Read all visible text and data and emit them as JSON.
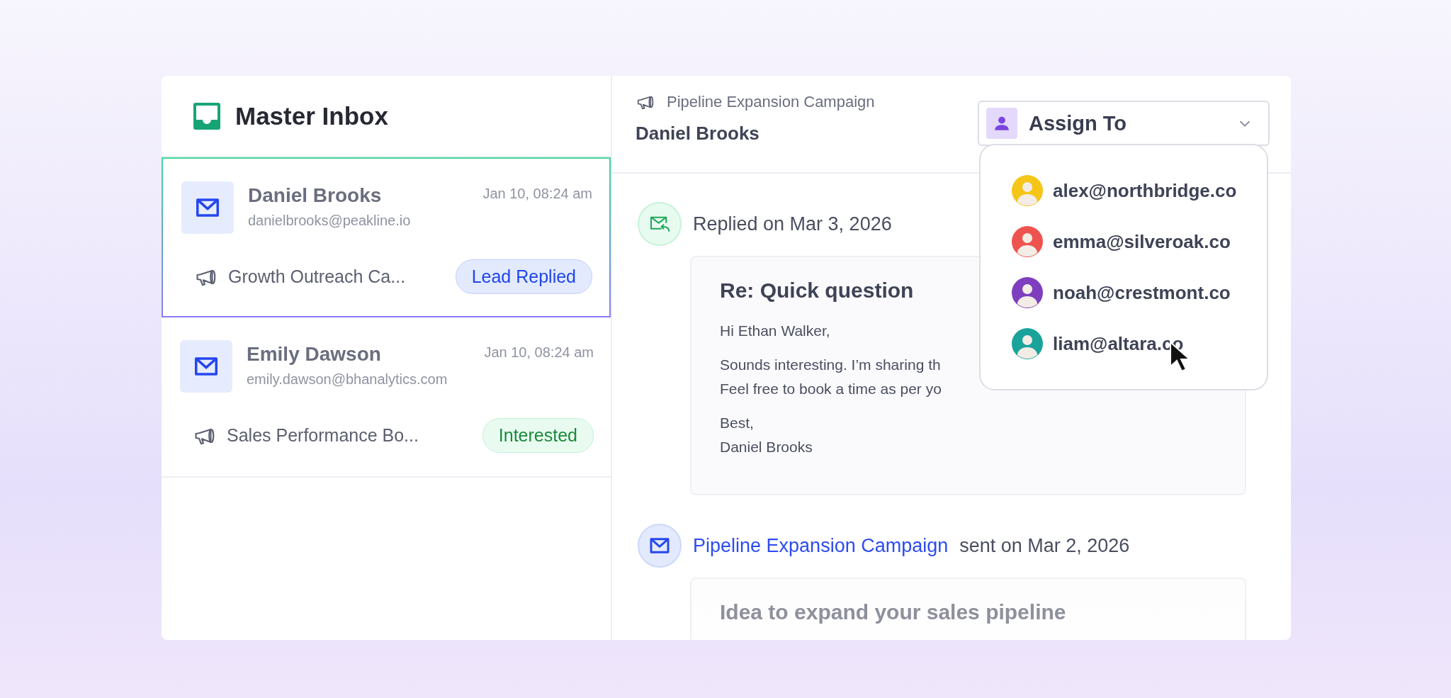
{
  "sidebar": {
    "title": "Master Inbox",
    "conversations": [
      {
        "name": "Daniel Brooks",
        "email": "danielbrooks@peakline.io",
        "time": "Jan 10, 08:24 am",
        "campaign": "Growth Outreach Ca...",
        "status": {
          "label": "Lead Replied",
          "kind": "lead_replied"
        },
        "selected": true
      },
      {
        "name": "Emily Dawson",
        "email": "emily.dawson@bhanalytics.com",
        "time": "Jan 10, 08:24 am",
        "campaign": "Sales Performance Bo...",
        "status": {
          "label": "Interested",
          "kind": "interested"
        },
        "selected": false
      }
    ]
  },
  "thread": {
    "campaign": "Pipeline Expansion Campaign",
    "contact": "Daniel Brooks",
    "assign": {
      "label": "Assign To",
      "expanded": true,
      "options": [
        {
          "email": "alex@northbridge.co",
          "color": "#f5c518"
        },
        {
          "email": "emma@silveroak.co",
          "color": "#ef5350"
        },
        {
          "email": "noah@crestmont.co",
          "color": "#7e3fbf"
        },
        {
          "email": "liam@altara.co",
          "color": "#1aa39a"
        }
      ]
    },
    "events": [
      {
        "kind": "reply",
        "text": "Replied on Mar 3, 2026",
        "message": {
          "subject": "Re: Quick question",
          "paragraphs": [
            [
              "Hi Ethan Walker,"
            ],
            [
              "Sounds interesting. I’m sharing th",
              "Feel free to book a time as per yo"
            ],
            [
              "Best,",
              "Daniel Brooks"
            ]
          ]
        }
      },
      {
        "kind": "sent",
        "link": "Pipeline Expansion Campaign",
        "text": "sent on Mar 2, 2026",
        "message": {
          "subject": "Idea to expand your sales pipeline"
        }
      }
    ]
  }
}
